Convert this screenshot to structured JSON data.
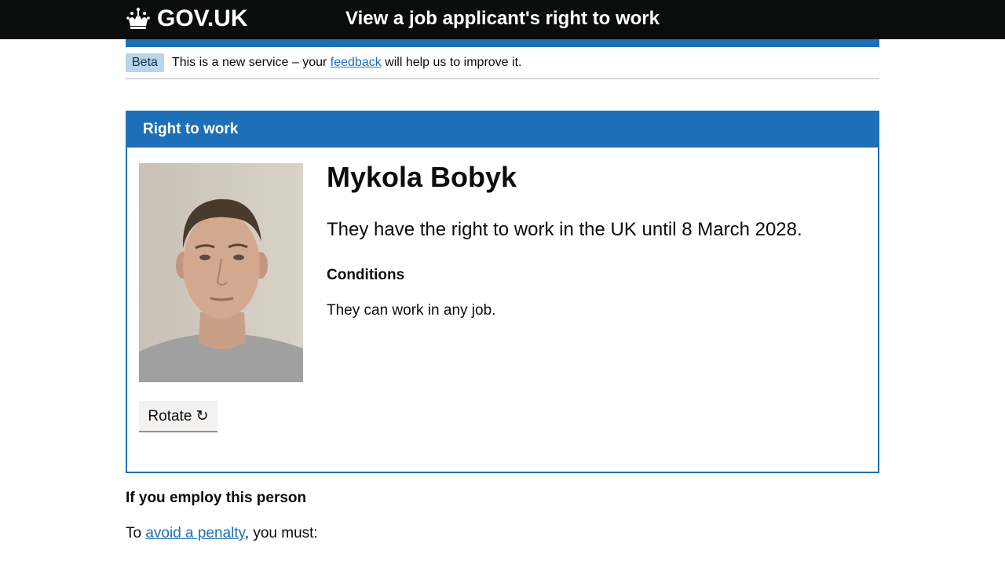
{
  "header": {
    "logo_text": "GOV.UK",
    "service_name": "View a job applicant's right to work",
    "background_color": "#0b0c0c",
    "accent_color": "#1d70b8"
  },
  "phase_banner": {
    "tag": "Beta",
    "text_before": "This is a new service – your ",
    "link_text": "feedback",
    "text_after": " will help us to improve it."
  },
  "panel": {
    "title": "Right to work",
    "photo_alt": "Photo of Mykola Bobyk",
    "rotate_button": "Rotate ↻",
    "name": "Mykola Bobyk",
    "status": "They have the right to work in the UK until 8 March 2028.",
    "conditions_heading": "Conditions",
    "conditions_text": "They can work in any job."
  },
  "employ": {
    "heading": "If you employ this person",
    "text_before": "To ",
    "link_text": "avoid a penalty",
    "text_after": ", you must:"
  }
}
